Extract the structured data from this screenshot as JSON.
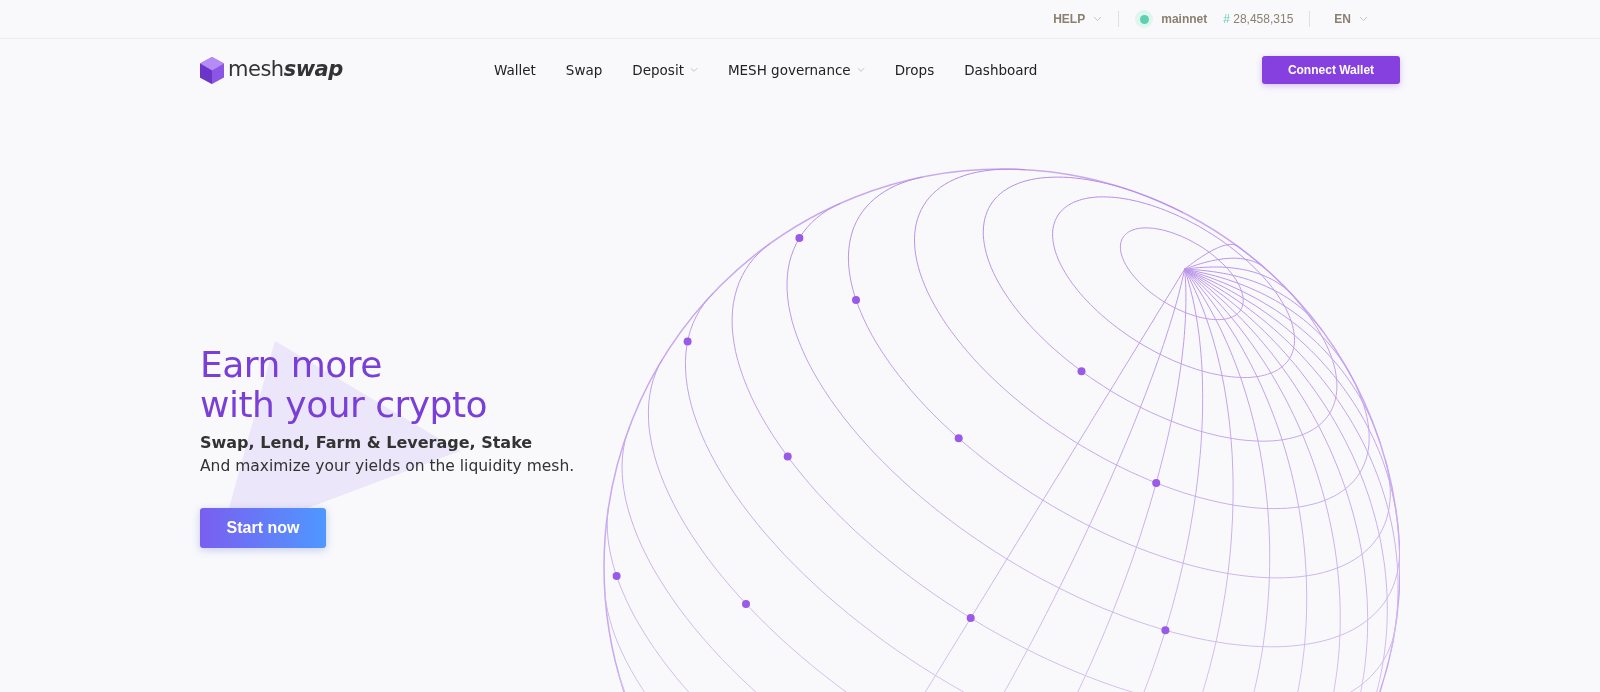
{
  "top_bar": {
    "help": "HELP",
    "network": "mainnet",
    "block_sign": "#",
    "block": "28,458,315",
    "language": "EN"
  },
  "header": {
    "logo": {
      "light": "mesh",
      "bold": "swap"
    },
    "nav": [
      {
        "label": "Wallet",
        "dropdown": false
      },
      {
        "label": "Swap",
        "dropdown": false
      },
      {
        "label": "Deposit",
        "dropdown": true
      },
      {
        "label": "MESH governance",
        "dropdown": true
      },
      {
        "label": "Drops",
        "dropdown": false
      },
      {
        "label": "Dashboard",
        "dropdown": false
      }
    ],
    "connect_button": "Connect Wallet"
  },
  "hero": {
    "title_lines": [
      "Earn more",
      "with your crypto"
    ],
    "subtitle": "Swap, Lend, Farm & Leverage, Stake",
    "description": "And maximize your yields on the liquidity mesh.",
    "button": "Start now"
  }
}
